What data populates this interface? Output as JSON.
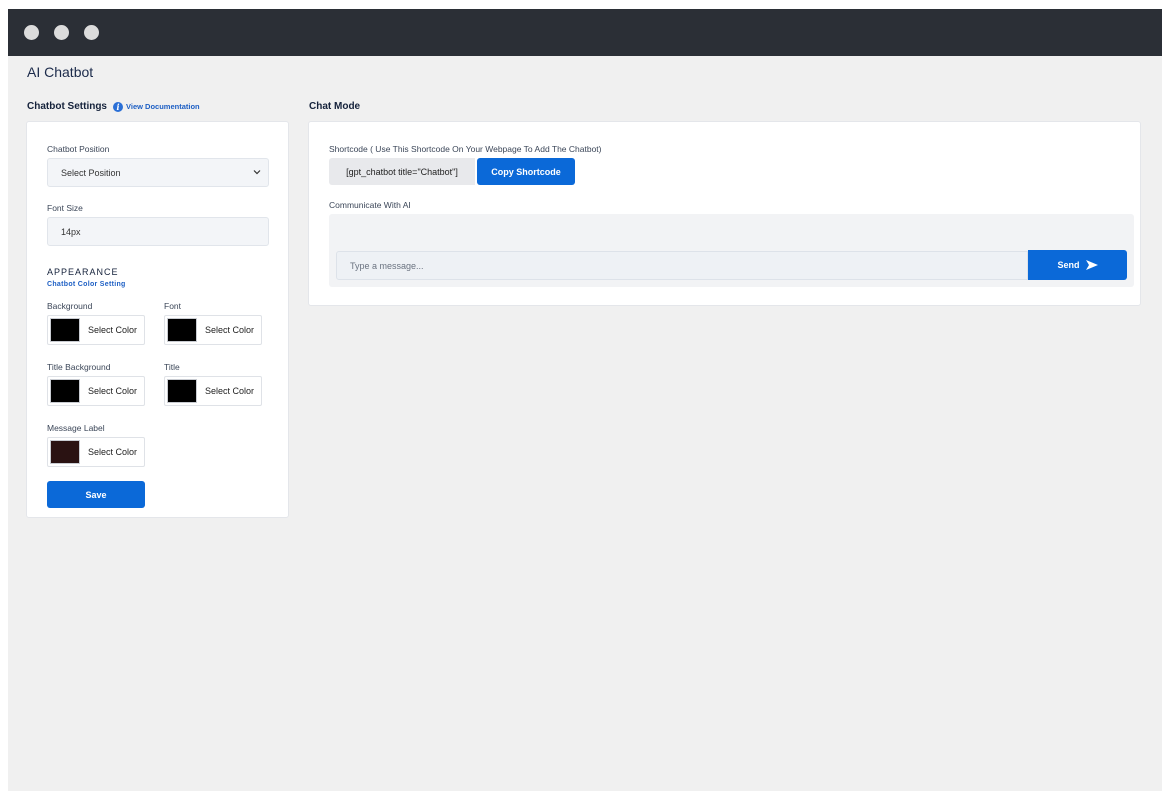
{
  "app": {
    "title": "AI Chatbot"
  },
  "settings": {
    "heading": "Chatbot Settings",
    "doc_link": "View Documentation",
    "position_label": "Chatbot Position",
    "position_value": "Select Position",
    "font_size_label": "Font Size",
    "font_size_value": "14px",
    "appearance_heading": "APPEARANCE",
    "appearance_sub": "Chatbot Color Setting",
    "colors": [
      {
        "label": "Background",
        "button": "Select Color",
        "swatch": "#000000"
      },
      {
        "label": "Font",
        "button": "Select Color",
        "swatch": "#000000"
      },
      {
        "label": "Title Background",
        "button": "Select Color",
        "swatch": "#000000"
      },
      {
        "label": "Title",
        "button": "Select Color",
        "swatch": "#000000"
      },
      {
        "label": "Message Label",
        "button": "Select Color",
        "swatch": "#2a1212"
      }
    ],
    "save_label": "Save"
  },
  "chat": {
    "heading": "Chat Mode",
    "shortcode_label": "Shortcode ( Use This Shortcode On Your Webpage To Add The Chatbot)",
    "shortcode_value": "[gpt_chatbot title=\"Chatbot\"]",
    "copy_label": "Copy Shortcode",
    "communicate_label": "Communicate With AI",
    "message_placeholder": "Type a message...",
    "send_label": "Send"
  },
  "theme": {
    "accent": "#0b69d8",
    "titlebar": "#2b2f36",
    "background": "#f0f0f0"
  }
}
